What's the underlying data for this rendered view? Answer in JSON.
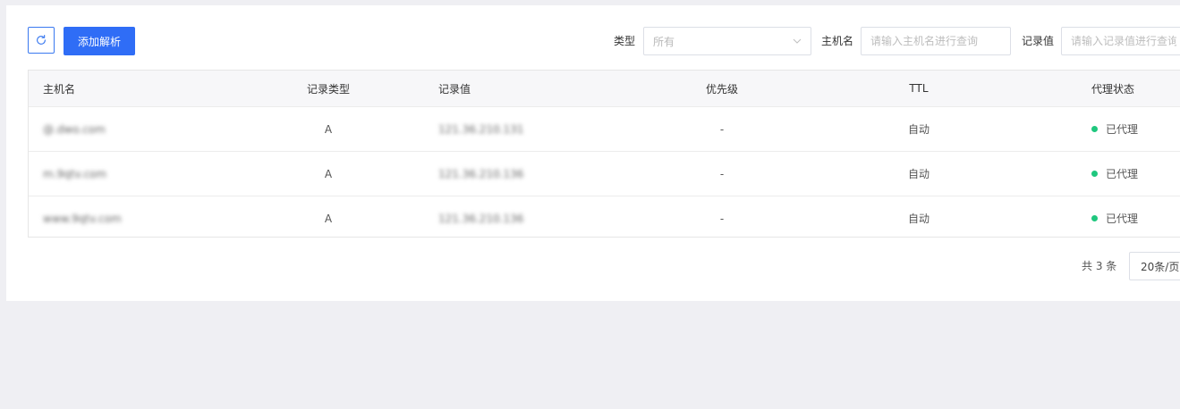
{
  "toolbar": {
    "add_label": "添加解析",
    "refresh_icon": "refresh-icon"
  },
  "filters": {
    "type_label": "类型",
    "type_value": "所有",
    "host_label": "主机名",
    "host_placeholder": "请输入主机名进行查询",
    "value_label": "记录值",
    "value_placeholder": "请输入记录值进行查询"
  },
  "table": {
    "headers": {
      "host": "主机名",
      "type": "记录类型",
      "value": "记录值",
      "priority": "优先级",
      "ttl": "TTL",
      "proxy": "代理状态"
    },
    "rows": [
      {
        "host": "@.dwo.com",
        "type": "A",
        "value": "121.36.210.131",
        "priority": "-",
        "ttl": "自动",
        "proxy": "已代理"
      },
      {
        "host": "m.9qtv.com",
        "type": "A",
        "value": "121.36.210.136",
        "priority": "-",
        "ttl": "自动",
        "proxy": "已代理"
      },
      {
        "host": "www.9qtv.com",
        "type": "A",
        "value": "121.36.210.136",
        "priority": "-",
        "ttl": "自动",
        "proxy": "已代理"
      }
    ]
  },
  "pagination": {
    "total": "共 3 条",
    "page_size": "20条/页"
  },
  "colors": {
    "primary": "#2f6df6",
    "status_green": "#1fc77e",
    "background": "#efeff3"
  }
}
